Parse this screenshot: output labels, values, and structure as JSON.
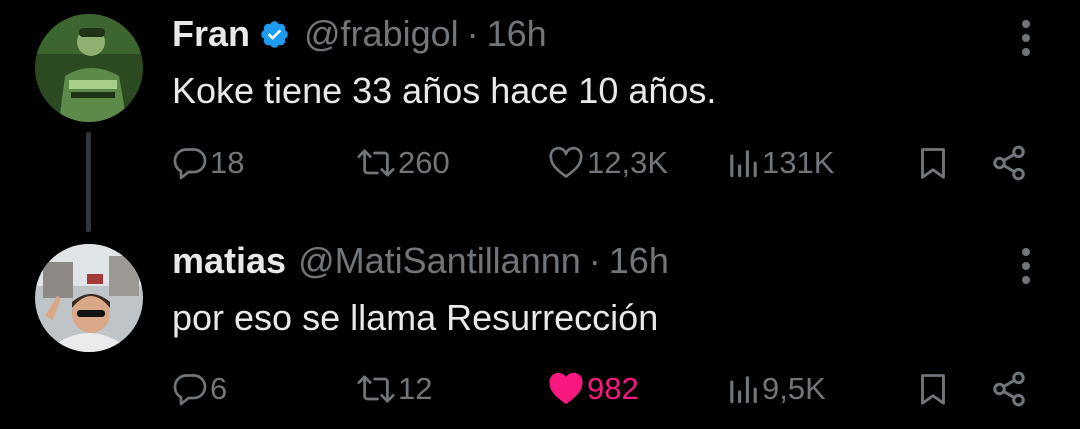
{
  "colors": {
    "background": "#000000",
    "primary_text": "#e7e9ea",
    "secondary_text": "#71767b",
    "verified_badge": "#1d9bf0",
    "like_active": "#f91880"
  },
  "tweets": [
    {
      "name": "Fran",
      "verified": true,
      "handle": "@frabigol",
      "separator": "·",
      "time": "16h",
      "text": "Koke tiene 33 años hace 10 años.",
      "icons": [
        "avatar",
        "verified-badge-icon",
        "more-options-icon",
        "reply-icon",
        "retweet-icon",
        "like-icon",
        "views-icon",
        "bookmark-icon",
        "share-icon"
      ],
      "stats": {
        "replies": "18",
        "retweets": "260",
        "likes": "12,3K",
        "views": "131K"
      },
      "liked": false
    },
    {
      "name": "matias",
      "verified": false,
      "handle": "@MatiSantillannn",
      "separator": "·",
      "time": "16h",
      "text": "por eso se llama Resurrección",
      "icons": [
        "avatar",
        "more-options-icon",
        "reply-icon",
        "retweet-icon",
        "like-filled-icon",
        "views-icon",
        "bookmark-icon",
        "share-icon"
      ],
      "stats": {
        "replies": "6",
        "retweets": "12",
        "likes": "982",
        "views": "9,5K"
      },
      "liked": true
    }
  ]
}
